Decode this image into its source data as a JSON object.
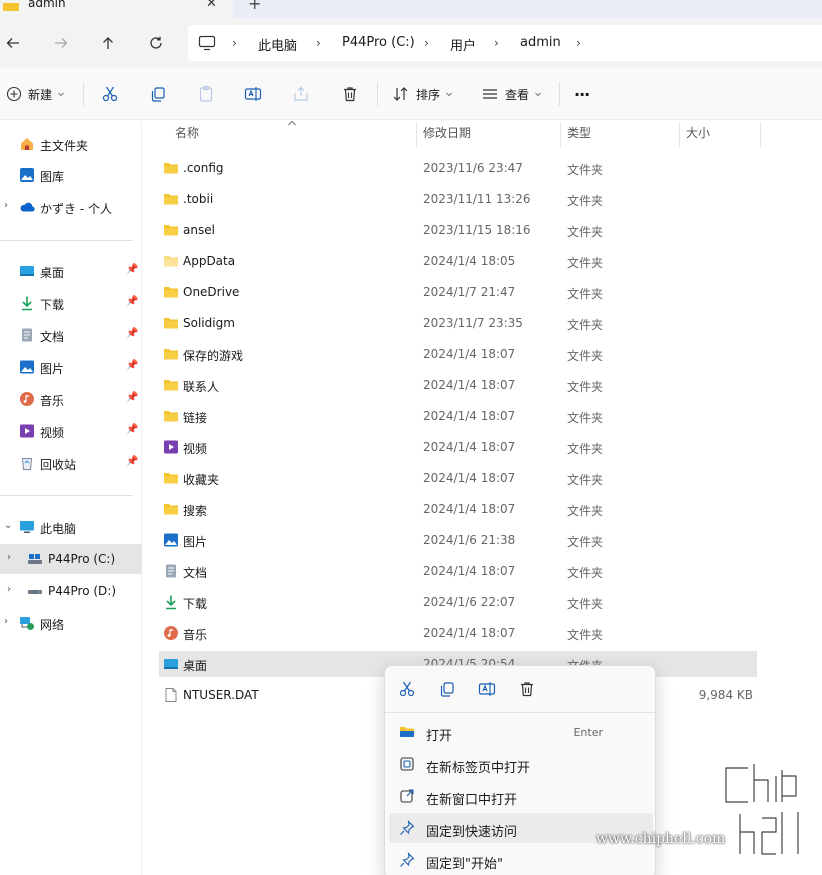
{
  "tab": {
    "title": "admin",
    "close": "✕",
    "new": "+"
  },
  "breadcrumb": [
    "此电脑",
    "P44Pro (C:)",
    "用户",
    "admin"
  ],
  "toolbar": {
    "new_label": "新建",
    "sort_label": "排序",
    "view_label": "查看",
    "more": "···"
  },
  "sidebar": {
    "quick": [
      {
        "label": "主文件夹",
        "icon": "home-icon"
      },
      {
        "label": "图库",
        "icon": "gallery-icon"
      },
      {
        "label": "かずき - 个人",
        "icon": "onedrive-icon"
      }
    ],
    "pinned": [
      {
        "label": "桌面",
        "icon": "desktop-icon"
      },
      {
        "label": "下载",
        "icon": "download-icon"
      },
      {
        "label": "文档",
        "icon": "document-icon"
      },
      {
        "label": "图片",
        "icon": "pictures-icon"
      },
      {
        "label": "音乐",
        "icon": "music-icon"
      },
      {
        "label": "视频",
        "icon": "video-icon"
      },
      {
        "label": "回收站",
        "icon": "recycle-bin-icon"
      }
    ],
    "tree": [
      {
        "label": "此电脑",
        "icon": "pc-icon"
      },
      {
        "label": "P44Pro (C:)",
        "icon": "drive-icon"
      },
      {
        "label": "P44Pro (D:)",
        "icon": "drive-icon"
      },
      {
        "label": "网络",
        "icon": "network-icon"
      }
    ]
  },
  "columns": {
    "name": "名称",
    "date": "修改日期",
    "type": "类型",
    "size": "大小"
  },
  "files": [
    {
      "name": ".config",
      "date": "2023/11/6 23:47",
      "type": "文件夹",
      "size": "",
      "icon": "folder"
    },
    {
      "name": ".tobii",
      "date": "2023/11/11 13:26",
      "type": "文件夹",
      "size": "",
      "icon": "folder"
    },
    {
      "name": "ansel",
      "date": "2023/11/15 18:16",
      "type": "文件夹",
      "size": "",
      "icon": "folder"
    },
    {
      "name": "AppData",
      "date": "2024/1/4 18:05",
      "type": "文件夹",
      "size": "",
      "icon": "folder-light"
    },
    {
      "name": "OneDrive",
      "date": "2024/1/7 21:47",
      "type": "文件夹",
      "size": "",
      "icon": "folder"
    },
    {
      "name": "Solidigm",
      "date": "2023/11/7 23:35",
      "type": "文件夹",
      "size": "",
      "icon": "folder"
    },
    {
      "name": "保存的游戏",
      "date": "2024/1/4 18:07",
      "type": "文件夹",
      "size": "",
      "icon": "folder"
    },
    {
      "name": "联系人",
      "date": "2024/1/4 18:07",
      "type": "文件夹",
      "size": "",
      "icon": "folder"
    },
    {
      "name": "链接",
      "date": "2024/1/4 18:07",
      "type": "文件夹",
      "size": "",
      "icon": "folder"
    },
    {
      "name": "视频",
      "date": "2024/1/4 18:07",
      "type": "文件夹",
      "size": "",
      "icon": "video"
    },
    {
      "name": "收藏夹",
      "date": "2024/1/4 18:07",
      "type": "文件夹",
      "size": "",
      "icon": "folder"
    },
    {
      "name": "搜索",
      "date": "2024/1/4 18:07",
      "type": "文件夹",
      "size": "",
      "icon": "folder"
    },
    {
      "name": "图片",
      "date": "2024/1/6 21:38",
      "type": "文件夹",
      "size": "",
      "icon": "pictures"
    },
    {
      "name": "文档",
      "date": "2024/1/4 18:07",
      "type": "文件夹",
      "size": "",
      "icon": "document"
    },
    {
      "name": "下载",
      "date": "2024/1/6 22:07",
      "type": "文件夹",
      "size": "",
      "icon": "download"
    },
    {
      "name": "音乐",
      "date": "2024/1/4 18:07",
      "type": "文件夹",
      "size": "",
      "icon": "music"
    },
    {
      "name": "桌面",
      "date": "2024/1/5 20:54",
      "type": "文件夹",
      "size": "",
      "icon": "desktop"
    },
    {
      "name": "NTUSER.DAT",
      "date": "",
      "type": "",
      "size": "9,984 KB",
      "icon": "file"
    }
  ],
  "context_menu": {
    "items": [
      {
        "label": "打开",
        "shortcut": "Enter",
        "icon": "open-folder-icon"
      },
      {
        "label": "在新标签页中打开",
        "shortcut": "",
        "icon": "new-tab-icon"
      },
      {
        "label": "在新窗口中打开",
        "shortcut": "",
        "icon": "new-window-icon"
      },
      {
        "label": "固定到快速访问",
        "shortcut": "",
        "icon": "pin-icon"
      },
      {
        "label": "固定到\"开始\"",
        "shortcut": "",
        "icon": "pin-start-icon"
      }
    ]
  },
  "watermark": {
    "text": "www.chiphell.com",
    "logo_text": "chip hell"
  },
  "colors": {
    "folder": "#f4c430",
    "folder_light": "#fbe08a",
    "accent": "#0067c0",
    "selection": "#e5e5e5"
  }
}
